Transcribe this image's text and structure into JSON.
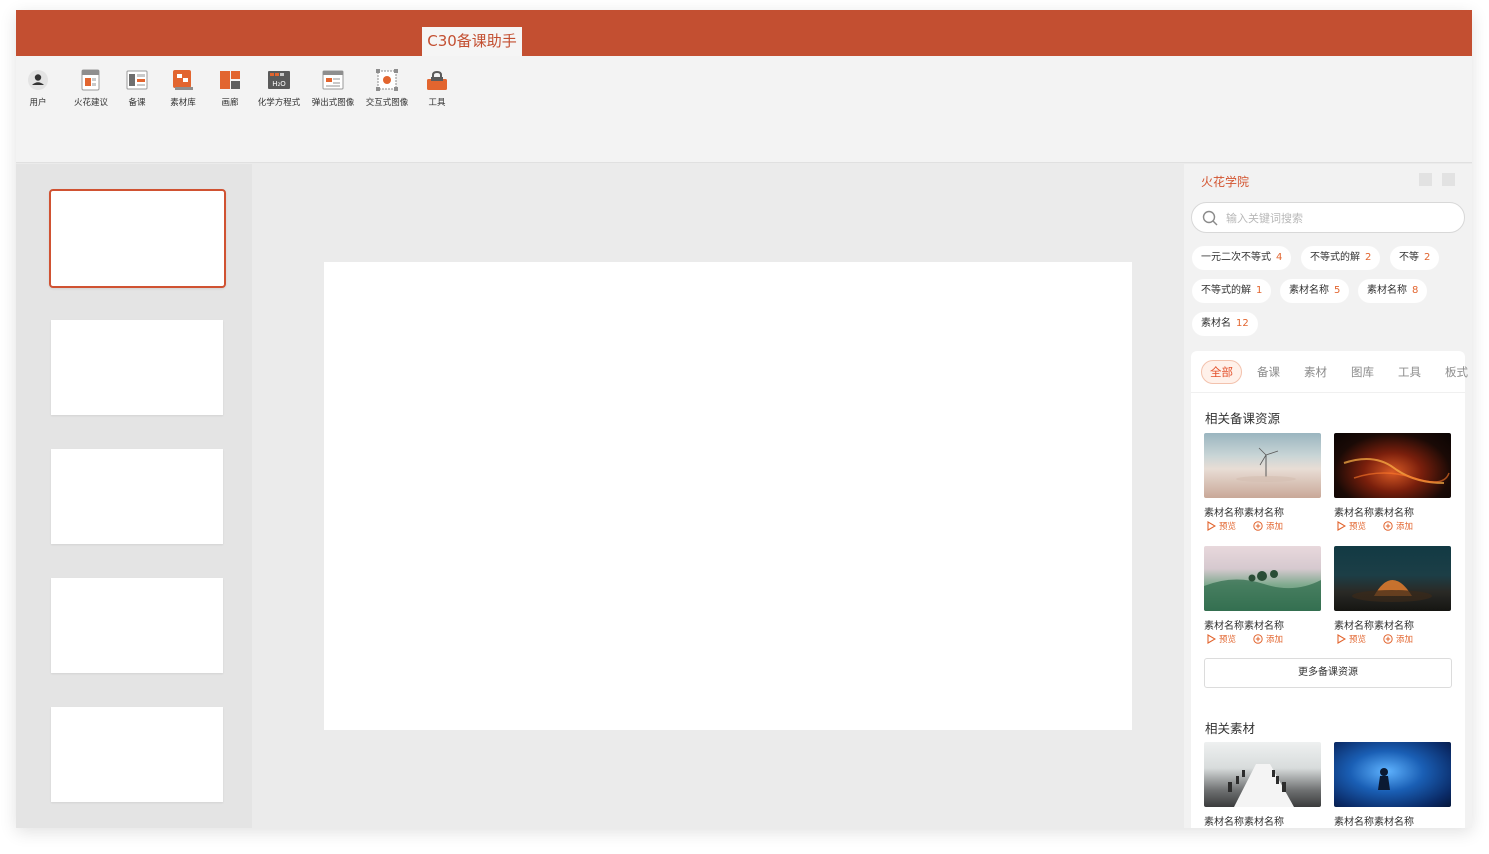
{
  "window": {
    "active_tab": "C30备课助手",
    "accent_color": "#c34f31"
  },
  "ribbon": {
    "tools": [
      {
        "label": "用户",
        "icon": "user-icon"
      },
      {
        "label": "火花建议",
        "icon": "spark-suggestion-icon"
      },
      {
        "label": "备课",
        "icon": "lesson-prep-icon"
      },
      {
        "label": "素材库",
        "icon": "material-library-icon"
      },
      {
        "label": "画廊",
        "icon": "gallery-icon"
      },
      {
        "label": "化学方程式",
        "icon": "chemical-equation-icon"
      },
      {
        "label": "弹出式图像",
        "icon": "popup-image-icon"
      },
      {
        "label": "交互式图像",
        "icon": "interactive-image-icon"
      },
      {
        "label": "工具",
        "icon": "toolbox-icon"
      }
    ]
  },
  "slides": {
    "count": 5,
    "selected_index": 0
  },
  "side_panel": {
    "title": "火花学院",
    "search": {
      "placeholder": "输入关键词搜索",
      "value": ""
    },
    "tags": [
      {
        "label": "一元二次不等式",
        "count": "4"
      },
      {
        "label": "不等式的解",
        "count": "2"
      },
      {
        "label": "不等",
        "count": "2"
      },
      {
        "label": "不等式的解",
        "count": "1"
      },
      {
        "label": "素材名称",
        "count": "5"
      },
      {
        "label": "素材名称",
        "count": "8"
      },
      {
        "label": "素材名",
        "count": "12"
      }
    ],
    "tabs": [
      "全部",
      "备课",
      "素材",
      "图库",
      "工具",
      "板式"
    ],
    "active_tab": "全部",
    "sections": {
      "lesson_resources": {
        "title": "相关备课资源",
        "items": [
          {
            "name": "素材名称素材名称",
            "preview": "预览",
            "add": "添加",
            "image": "misty-sea-wind-turbine"
          },
          {
            "name": "素材名称素材名称",
            "preview": "预览",
            "add": "添加",
            "image": "lava-flow-night"
          },
          {
            "name": "素材名称素材名称",
            "preview": "预览",
            "add": "添加",
            "image": "green-wave-forest"
          },
          {
            "name": "素材名称素材名称",
            "preview": "预览",
            "add": "添加",
            "image": "glowing-desert-tent"
          }
        ],
        "more_label": "更多备课资源"
      },
      "materials": {
        "title": "相关素材",
        "items": [
          {
            "name": "素材名称素材名称",
            "image": "dining-hall"
          },
          {
            "name": "素材名称素材名称",
            "image": "ice-cave-explorer"
          }
        ]
      }
    }
  }
}
